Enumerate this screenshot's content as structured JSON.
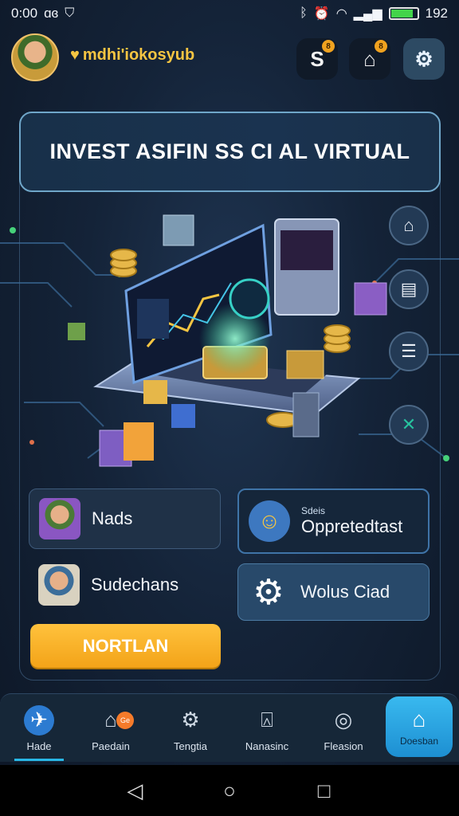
{
  "status_bar": {
    "time": "0:00",
    "left_text": "ɑɞ",
    "right_text": "192",
    "icons": [
      "shield-icon",
      "bluetooth-icon",
      "alarm-icon",
      "wifi-icon",
      "signal-icon",
      "battery-icon"
    ]
  },
  "header": {
    "app_title": "mdhi'iokosyub",
    "btn_1_label": "S",
    "btn_1_badge": "8",
    "btn_2_badge": "8"
  },
  "banner": {
    "title": "INVEST ASIFIN SS CI AL VIRTUAL"
  },
  "side_icons": [
    "bank-icon",
    "chart-box-icon",
    "document-icon",
    "x-icon"
  ],
  "cards": {
    "nads": {
      "label": "Nads"
    },
    "oppre": {
      "sublabel": "Sdeis",
      "label": "Oppretedtast"
    },
    "subs": {
      "label": "Sudechans"
    },
    "wolus": {
      "label": "Wolus Ciad"
    }
  },
  "cta": {
    "label": "NORTLAN"
  },
  "bottom_nav": {
    "items": [
      {
        "label": "Hade",
        "icon": "home-icon",
        "active": true
      },
      {
        "label": "Paedain",
        "icon": "house-icon",
        "badge": "Ge"
      },
      {
        "label": "Tengtia",
        "icon": "gear-icon"
      },
      {
        "label": "Nanasinc",
        "icon": "clipboard-icon"
      },
      {
        "label": "Fleasion",
        "icon": "compass-icon"
      }
    ],
    "fab": {
      "label": "Doesban",
      "icon": "wallet-icon"
    }
  },
  "system_nav": {
    "back": "◁",
    "home": "○",
    "recent": "□"
  },
  "colors": {
    "accent": "#f5c542",
    "primary": "#2c7bd1",
    "cta": "#f3a318",
    "background": "#142338"
  }
}
